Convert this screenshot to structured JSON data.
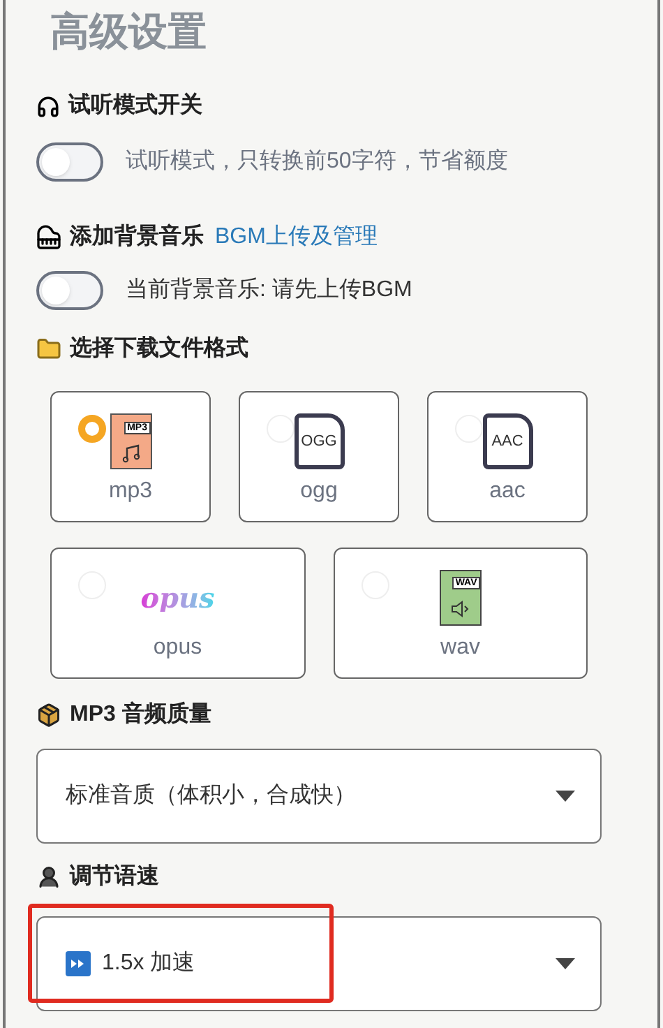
{
  "title": "高级设置",
  "preview": {
    "heading": "试听模式开关",
    "on": false,
    "description": "试听模式，只转换前50字符，节省额度"
  },
  "bgm": {
    "heading": "添加背景音乐",
    "link": "BGM上传及管理",
    "on": false,
    "description": "当前背景音乐: 请先上传BGM"
  },
  "format": {
    "heading": "选择下载文件格式",
    "options": [
      {
        "label": "mp3",
        "kind": "music",
        "icon_text": "MP3",
        "selected": true
      },
      {
        "label": "ogg",
        "kind": "doc",
        "icon_text": "OGG",
        "selected": false
      },
      {
        "label": "aac",
        "kind": "doc",
        "icon_text": "AAC",
        "selected": false
      },
      {
        "label": "opus",
        "kind": "wordmark",
        "icon_text": "opus",
        "selected": false
      },
      {
        "label": "wav",
        "kind": "speaker",
        "icon_text": "WAV",
        "selected": false
      }
    ]
  },
  "quality": {
    "heading": "MP3 音频质量",
    "value": "标准音质（体积小，合成快）"
  },
  "speed": {
    "heading": "调节语速",
    "value": "1.5x 加速",
    "highlighted": true
  }
}
